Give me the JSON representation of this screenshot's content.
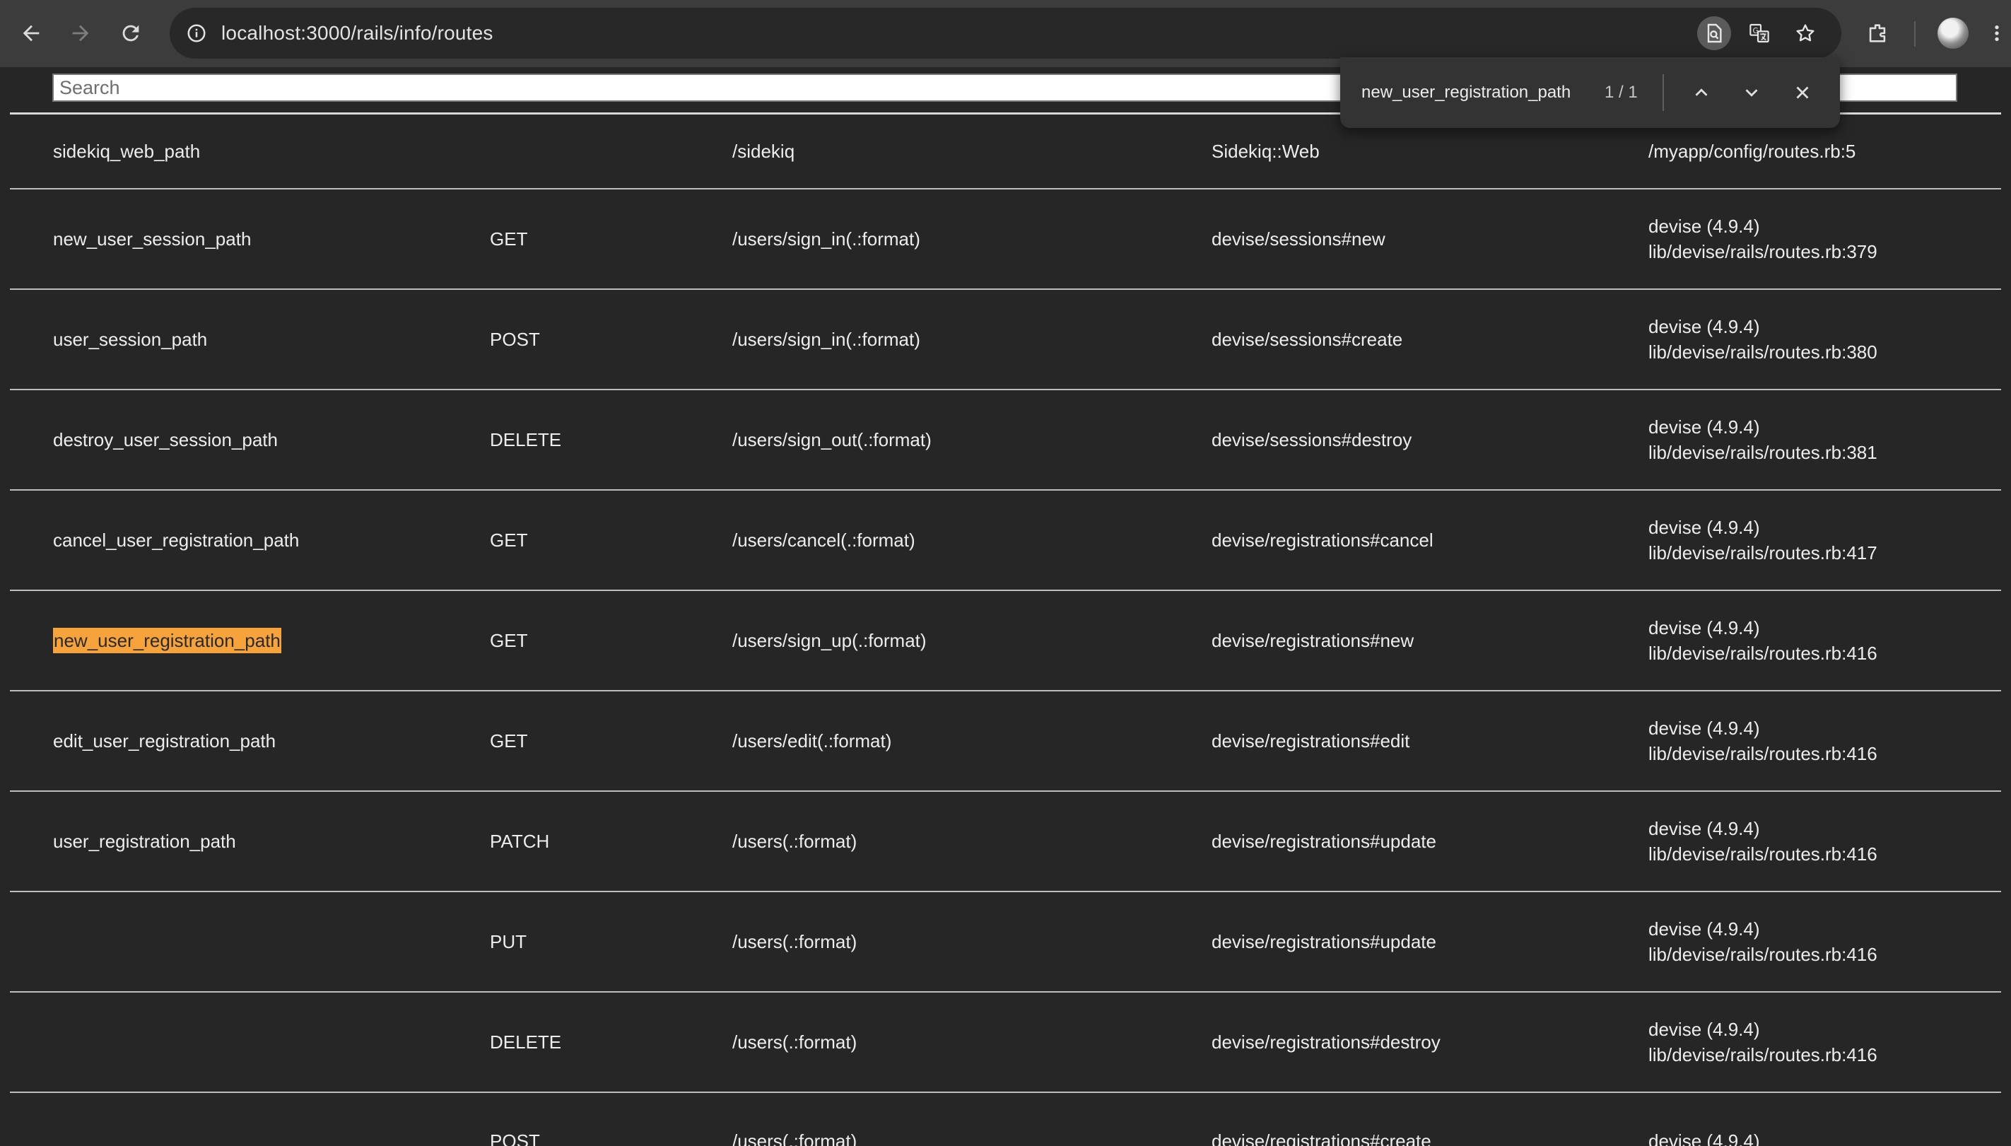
{
  "browser": {
    "url": "localhost:3000/rails/info/routes"
  },
  "find_bar": {
    "query": "new_user_registration_path",
    "count": "1 / 1"
  },
  "search": {
    "placeholder": "Search"
  },
  "routes": [
    {
      "name": "sidekiq_web_path",
      "verb": "",
      "path": "/sidekiq",
      "controller": "Sidekiq::Web",
      "source": [
        "/myapp/config/routes.rb:5"
      ]
    },
    {
      "name": "new_user_session_path",
      "verb": "GET",
      "path": "/users/sign_in(.:format)",
      "controller": "devise/sessions#new",
      "source": [
        "devise (4.9.4)",
        "lib/devise/rails/routes.rb:379"
      ]
    },
    {
      "name": "user_session_path",
      "verb": "POST",
      "path": "/users/sign_in(.:format)",
      "controller": "devise/sessions#create",
      "source": [
        "devise (4.9.4)",
        "lib/devise/rails/routes.rb:380"
      ]
    },
    {
      "name": "destroy_user_session_path",
      "verb": "DELETE",
      "path": "/users/sign_out(.:format)",
      "controller": "devise/sessions#destroy",
      "source": [
        "devise (4.9.4)",
        "lib/devise/rails/routes.rb:381"
      ]
    },
    {
      "name": "cancel_user_registration_path",
      "verb": "GET",
      "path": "/users/cancel(.:format)",
      "controller": "devise/registrations#cancel",
      "source": [
        "devise (4.9.4)",
        "lib/devise/rails/routes.rb:417"
      ]
    },
    {
      "name": "new_user_registration_path",
      "verb": "GET",
      "path": "/users/sign_up(.:format)",
      "controller": "devise/registrations#new",
      "source": [
        "devise (4.9.4)",
        "lib/devise/rails/routes.rb:416"
      ]
    },
    {
      "name": "edit_user_registration_path",
      "verb": "GET",
      "path": "/users/edit(.:format)",
      "controller": "devise/registrations#edit",
      "source": [
        "devise (4.9.4)",
        "lib/devise/rails/routes.rb:416"
      ]
    },
    {
      "name": "user_registration_path",
      "verb": "PATCH",
      "path": "/users(.:format)",
      "controller": "devise/registrations#update",
      "source": [
        "devise (4.9.4)",
        "lib/devise/rails/routes.rb:416"
      ]
    },
    {
      "name": "",
      "verb": "PUT",
      "path": "/users(.:format)",
      "controller": "devise/registrations#update",
      "source": [
        "devise (4.9.4)",
        "lib/devise/rails/routes.rb:416"
      ]
    },
    {
      "name": "",
      "verb": "DELETE",
      "path": "/users(.:format)",
      "controller": "devise/registrations#destroy",
      "source": [
        "devise (4.9.4)",
        "lib/devise/rails/routes.rb:416"
      ]
    },
    {
      "name": "",
      "verb": "POST",
      "path": "/users(.:format)",
      "controller": "devise/registrations#create",
      "source": [
        "devise (4.9.4)"
      ]
    }
  ]
}
